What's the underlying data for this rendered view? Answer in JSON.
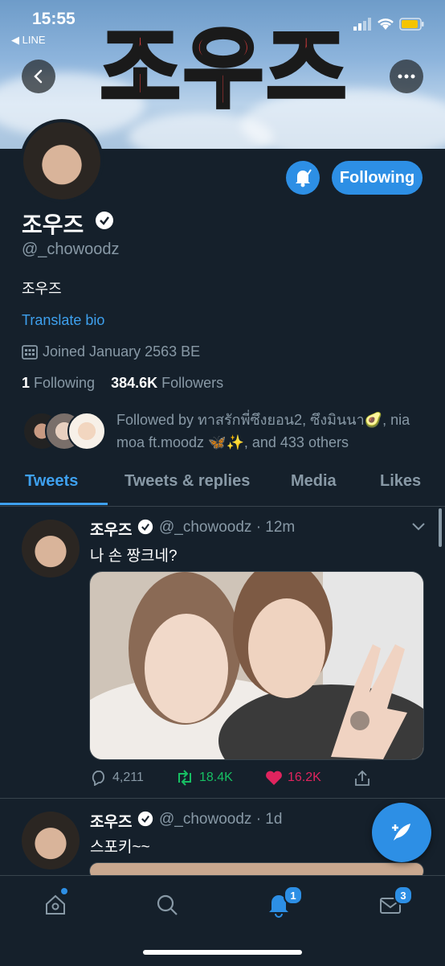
{
  "status_bar": {
    "time": "15:55",
    "back_app": "◀ LINE"
  },
  "banner": {
    "title": "조우즈"
  },
  "profile": {
    "display_name": "조우즈",
    "handle": "@_chowoodz",
    "bio": "조우즈",
    "translate_label": "Translate bio",
    "joined": "Joined January 2563 BE",
    "following_count": "1",
    "following_label": "Following",
    "followers_count": "384.6K",
    "followers_label": "Followers",
    "followed_by": "Followed by ทาสรักพี่ซึงยอน2, ซึงมินนา🥑, nia moa ft.moodz 🦋✨, and 433 others",
    "following_button": "Following"
  },
  "tabs": [
    {
      "label": "Tweets",
      "active": true
    },
    {
      "label": "Tweets & replies",
      "active": false
    },
    {
      "label": "Media",
      "active": false
    },
    {
      "label": "Likes",
      "active": false
    }
  ],
  "tweets": [
    {
      "name": "조우즈",
      "handle_time": "@_chowoodz · 12m",
      "text": "나 손 짱크네?",
      "replies": "4,211",
      "retweets": "18.4K",
      "likes": "16.2K"
    },
    {
      "name": "조우즈",
      "handle_time": "@_chowoodz · 1d",
      "text": "스포키~~"
    }
  ],
  "nav": {
    "notifications_badge": "1",
    "messages_badge": "3"
  },
  "colors": {
    "accent": "#2d8fe5",
    "background": "#15202b",
    "retweet": "#17bf63",
    "like": "#e0245e",
    "muted": "#8899a6"
  }
}
